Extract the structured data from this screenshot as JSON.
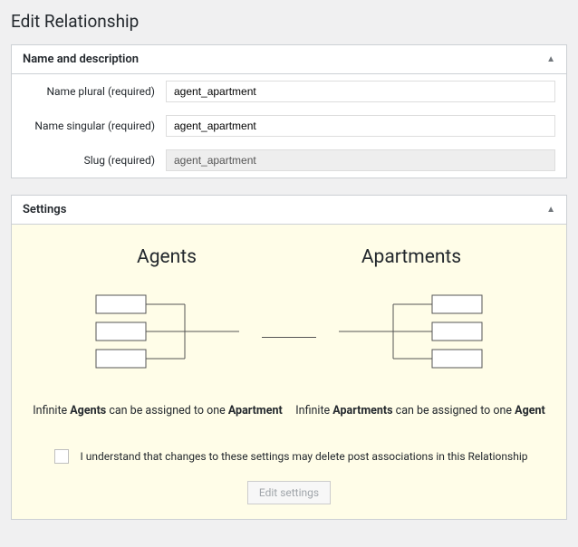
{
  "page": {
    "title": "Edit Relationship"
  },
  "name_panel": {
    "header": "Name and description",
    "fields": {
      "name_plural": {
        "label": "Name plural (required)",
        "value": "agent_apartment"
      },
      "name_singular": {
        "label": "Name singular (required)",
        "value": "agent_apartment"
      },
      "slug": {
        "label": "Slug (required)",
        "value": "agent_apartment"
      }
    }
  },
  "settings_panel": {
    "header": "Settings",
    "left": {
      "title": "Agents",
      "caption_prefix": "Infinite ",
      "caption_strong1": "Agents",
      "caption_mid": " can be assigned to one ",
      "caption_strong2": "Apartment"
    },
    "right": {
      "title": "Apartments",
      "caption_prefix": "Infinite ",
      "caption_strong1": "Apartments",
      "caption_mid": " can be assigned to one ",
      "caption_strong2": "Agent"
    },
    "confirm_label": "I understand that changes to these settings may delete post associations in this Relationship",
    "button_label": "Edit settings"
  }
}
